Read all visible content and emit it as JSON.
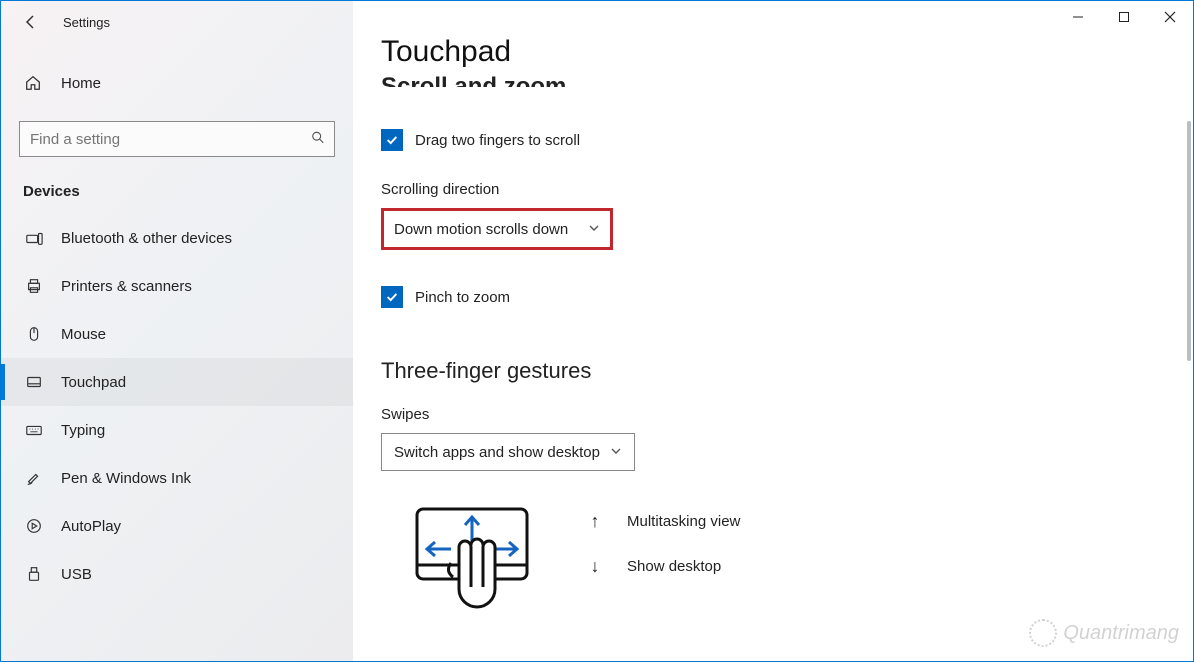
{
  "window": {
    "app_title": "Settings"
  },
  "sidebar": {
    "home_label": "Home",
    "search_placeholder": "Find a setting",
    "category": "Devices",
    "items": [
      {
        "icon": "bluetooth",
        "label": "Bluetooth & other devices"
      },
      {
        "icon": "printer",
        "label": "Printers & scanners"
      },
      {
        "icon": "mouse",
        "label": "Mouse"
      },
      {
        "icon": "touchpad",
        "label": "Touchpad",
        "selected": true
      },
      {
        "icon": "keyboard",
        "label": "Typing"
      },
      {
        "icon": "pen",
        "label": "Pen & Windows Ink"
      },
      {
        "icon": "autoplay",
        "label": "AutoPlay"
      },
      {
        "icon": "usb",
        "label": "USB"
      }
    ]
  },
  "main": {
    "page_title": "Touchpad",
    "clipped_section": "Scroll and zoom",
    "check1_label": "Drag two fingers to scroll",
    "check1_checked": true,
    "scroll_dir_label": "Scrolling direction",
    "scroll_dir_value": "Down motion scrolls down",
    "check2_label": "Pinch to zoom",
    "check2_checked": true,
    "three_finger_header": "Three-finger gestures",
    "swipes_label": "Swipes",
    "swipes_value": "Switch apps and show desktop",
    "gesture_rows": [
      {
        "arrow": "↑",
        "label": "Multitasking view"
      },
      {
        "arrow": "↓",
        "label": "Show desktop"
      }
    ]
  },
  "watermark": "Quantrimang"
}
